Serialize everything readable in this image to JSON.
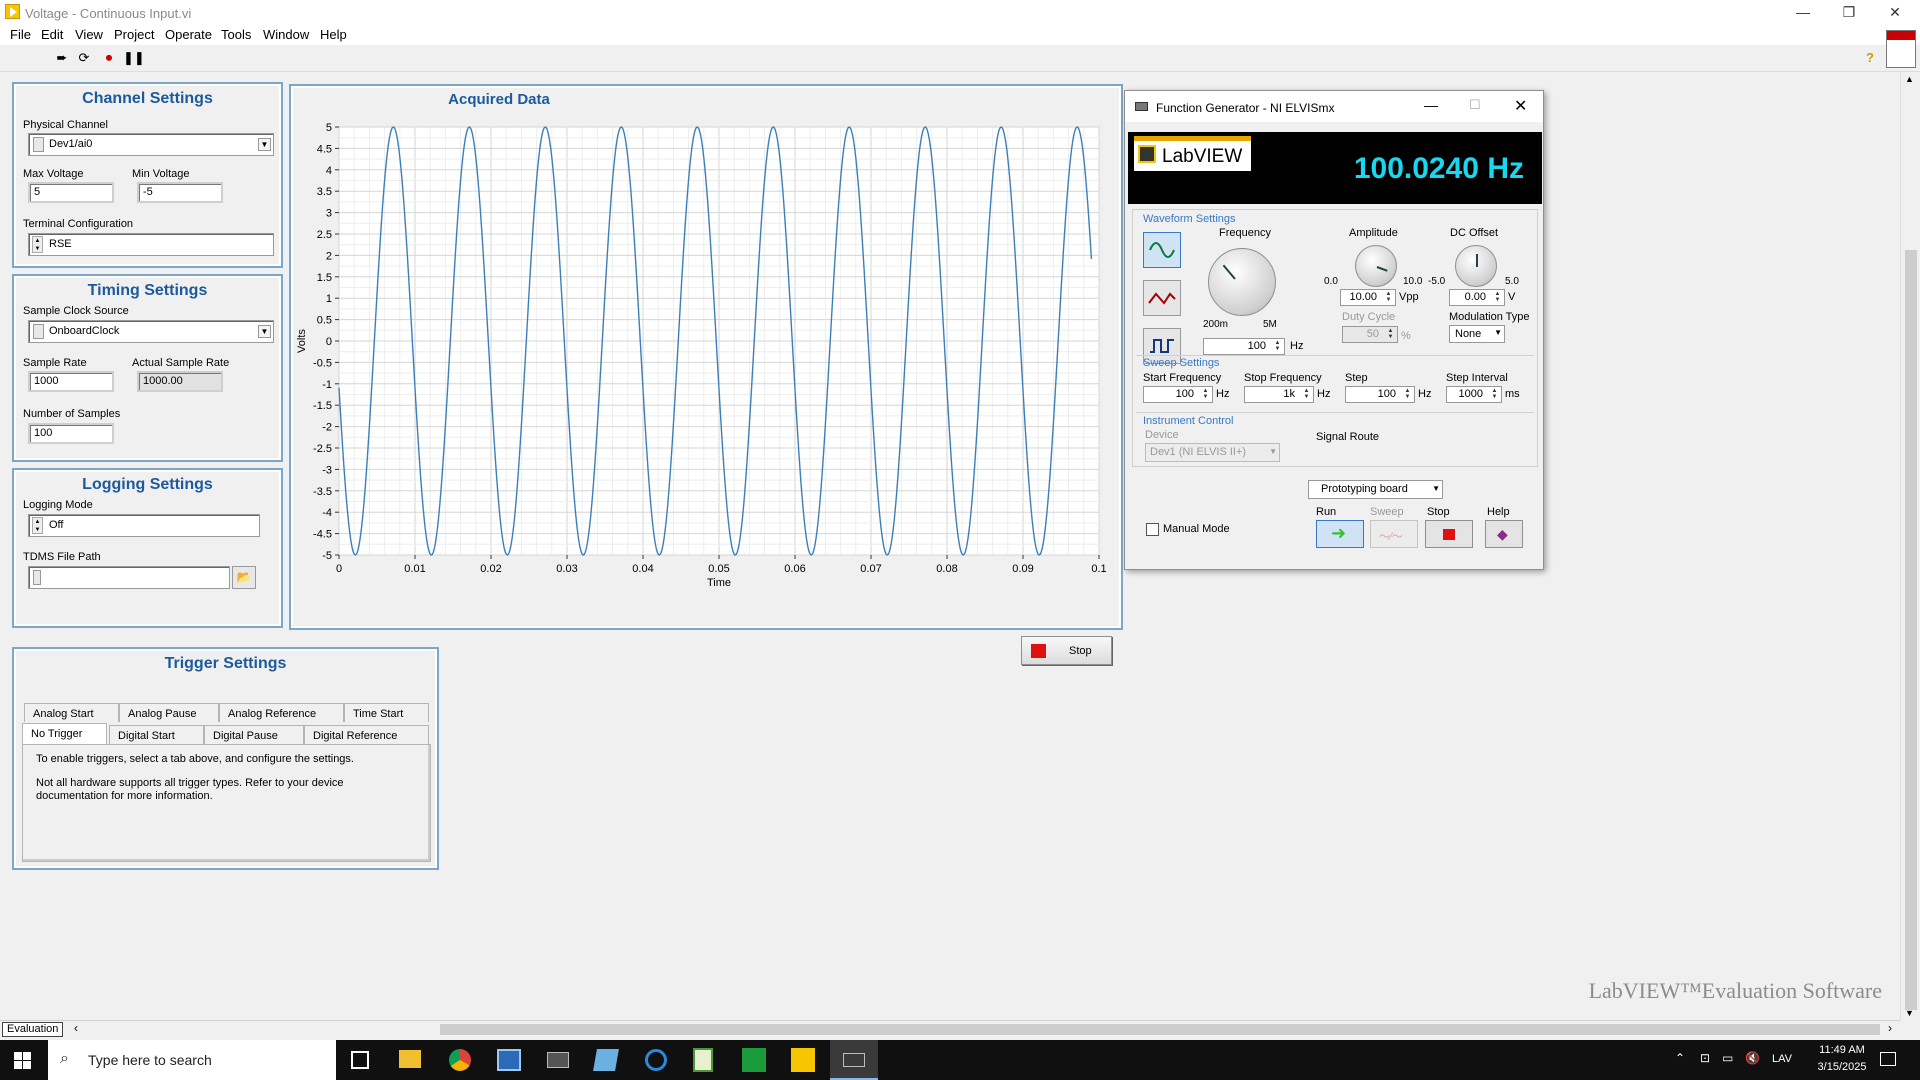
{
  "window": {
    "title": "Voltage - Continuous Input.vi"
  },
  "menu": [
    "File",
    "Edit",
    "View",
    "Project",
    "Operate",
    "Tools",
    "Window",
    "Help"
  ],
  "channel": {
    "title": "Channel Settings",
    "physical_label": "Physical Channel",
    "physical_value": "Dev1/ai0",
    "max_label": "Max Voltage",
    "max_value": "5",
    "min_label": "Min Voltage",
    "min_value": "-5",
    "term_label": "Terminal Configuration",
    "term_value": "RSE"
  },
  "timing": {
    "title": "Timing Settings",
    "clock_label": "Sample Clock Source",
    "clock_value": "OnboardClock",
    "rate_label": "Sample Rate",
    "rate_value": "1000",
    "actual_label": "Actual Sample Rate",
    "actual_value": "1000.00",
    "num_label": "Number of Samples",
    "num_value": "100"
  },
  "logging": {
    "title": "Logging Settings",
    "mode_label": "Logging Mode",
    "mode_value": "Off",
    "path_label": "TDMS File Path"
  },
  "trigger": {
    "title": "Trigger Settings",
    "tabs_row1": [
      "Analog Start",
      "Analog Pause",
      "Analog Reference",
      "Time Start"
    ],
    "tabs_row2": [
      "No Trigger",
      "Digital Start",
      "Digital Pause",
      "Digital Reference"
    ],
    "text1": "To enable triggers, select a tab above, and configure the settings.",
    "text2": "Not all hardware supports all trigger types. Refer to your device documentation for more information."
  },
  "chart_data": {
    "type": "line",
    "title": "Acquired Data",
    "xlabel": "Time",
    "ylabel": "Volts",
    "xlim": [
      0,
      0.1
    ],
    "ylim": [
      -5,
      5
    ],
    "frequency_hz": 100.024,
    "amplitude": 5,
    "xticks": [
      "0",
      "0.01",
      "0.02",
      "0.03",
      "0.04",
      "0.05",
      "0.06",
      "0.07",
      "0.08",
      "0.09",
      "0.1"
    ],
    "yticks": [
      "5",
      "4.5",
      "4",
      "3.5",
      "3",
      "2.5",
      "2",
      "1.5",
      "1",
      "0.5",
      "0",
      "-0.5",
      "-1",
      "-1.5",
      "-2",
      "-2.5",
      "-3",
      "-3.5",
      "-4",
      "-4.5",
      "-5"
    ],
    "grid": true,
    "color": "#3c7fb8"
  },
  "stop_button": "Stop",
  "fg": {
    "title": "Function Generator - NI ELVISmx",
    "logo": "LabVIEW",
    "freq_display": "100.0240 Hz",
    "waveform_label": "Waveform Settings",
    "frequency_label": "Frequency",
    "freq_min": "200m",
    "freq_max": "5M",
    "freq_value": "100",
    "freq_unit": "Hz",
    "amp_label": "Amplitude",
    "amp_min": "0.0",
    "amp_max": "10.0",
    "amp_value": "10.00",
    "amp_unit": "Vpp",
    "dc_label": "DC Offset",
    "dc_min": "-5.0",
    "dc_max": "5.0",
    "dc_value": "0.00",
    "dc_unit": "V",
    "duty_label": "Duty Cycle",
    "duty_value": "50",
    "duty_unit": "%",
    "mod_label": "Modulation Type",
    "mod_value": "None",
    "sweep_label": "Sweep Settings",
    "start_label": "Start Frequency",
    "start_value": "100",
    "stop_label": "Stop Frequency",
    "stop_value": "1k",
    "step_label": "Step",
    "step_value": "100",
    "interval_label": "Step Interval",
    "interval_value": "1000",
    "hz": "Hz",
    "ms": "ms",
    "ic_label": "Instrument Control",
    "device_label": "Device",
    "device_value": "Dev1 (NI ELVIS II+)",
    "route_label": "Signal Route",
    "route_value": "Prototyping board",
    "manual_label": "Manual Mode",
    "run_label": "Run",
    "sweep_btn_label": "Sweep",
    "stop_btn_label": "Stop",
    "help_label": "Help"
  },
  "watermark": "LabVIEW™Evaluation Software",
  "status": {
    "tag": "Evaluation"
  },
  "taskbar": {
    "search": "Type here to search",
    "lang": "LAV",
    "time": "11:49 AM",
    "date": "3/15/2025"
  },
  "colors": {
    "accent": "#1d5a9c",
    "lcd_text": "#18d8f0",
    "lcd_bg": "#000000",
    "run_green": "#2ec42e",
    "stop_red": "#e01010"
  }
}
